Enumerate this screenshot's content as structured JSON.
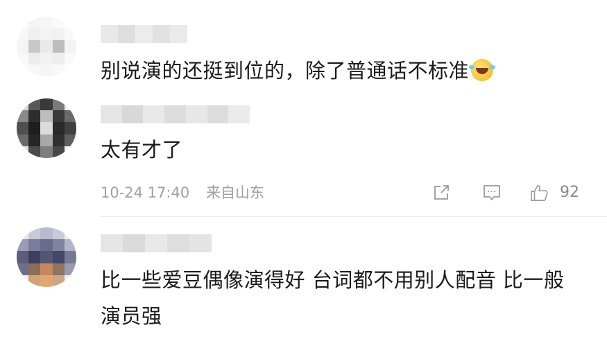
{
  "comments": [
    {
      "text": "别说演的还挺到位的，除了普通话不标准",
      "emoji": "laughing-tears-emoji"
    },
    {
      "text": "太有才了",
      "time": "10-24 17:40",
      "location": "来自山东",
      "like_count": "92",
      "icons": [
        "share-icon",
        "comment-icon",
        "like-icon"
      ]
    },
    {
      "text": "比一些爱豆偶像演得好 台词都不用别人配音 比一般演员强"
    }
  ],
  "colors": {
    "text": "#1a1a1a",
    "meta": "#a0a0a0",
    "divider": "#ececec"
  }
}
